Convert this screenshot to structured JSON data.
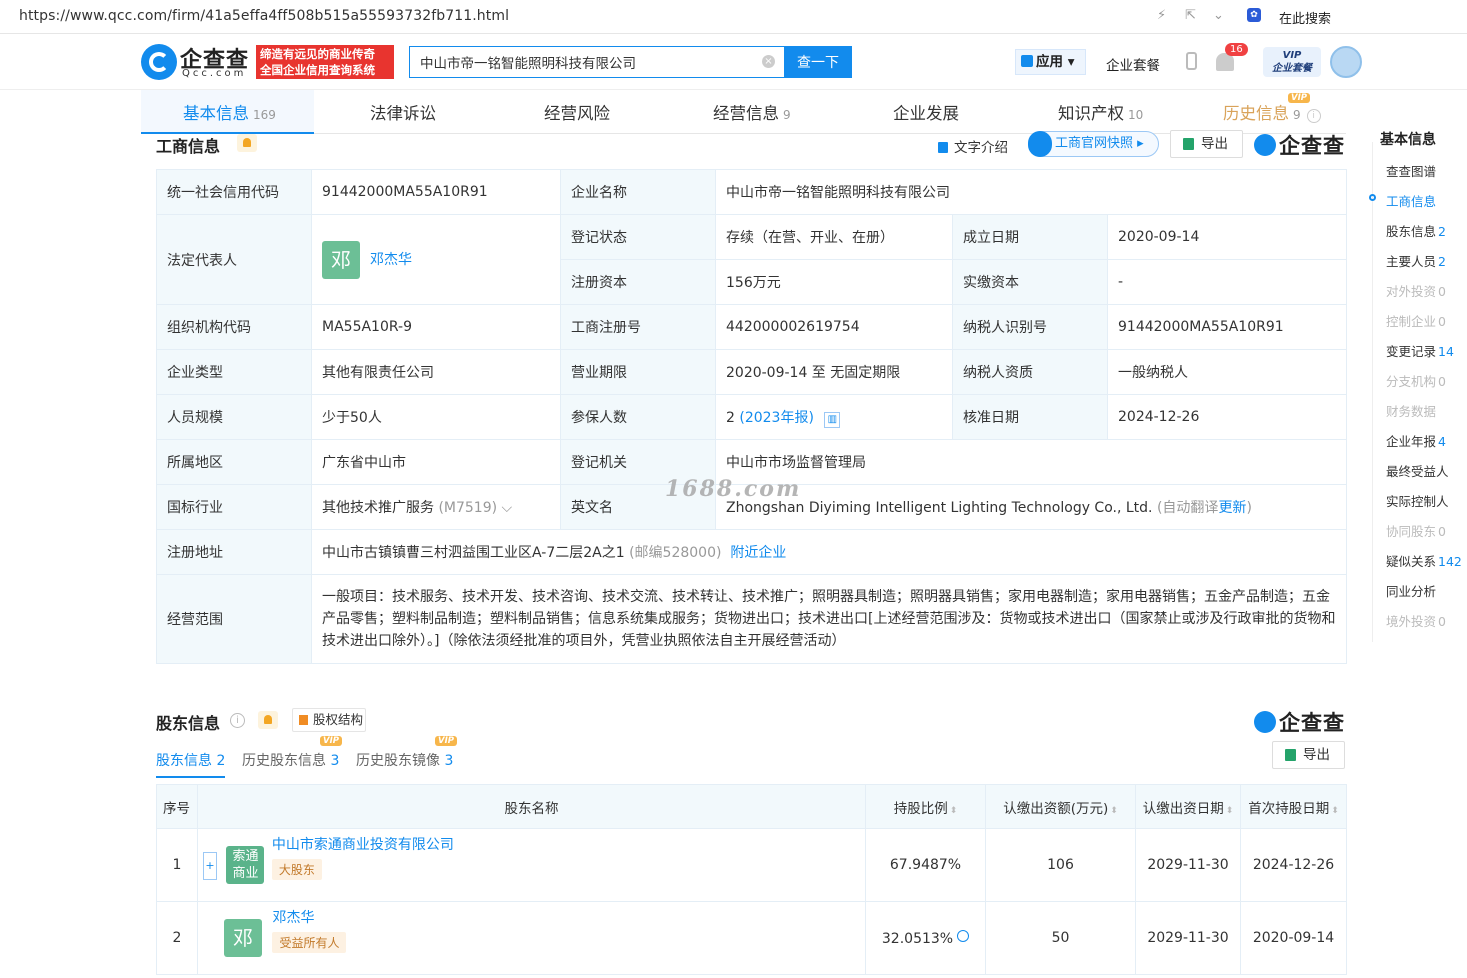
{
  "browser": {
    "url": "https://www.qcc.com/firm/41a5effa4ff508b515a55593732fb711.html",
    "search_label": "在此搜索"
  },
  "header": {
    "logo_text": "企查查",
    "logo_sub": "Qcc.com",
    "slogan_line1": "缔造有远见的商业传奇",
    "slogan_line2": "全国企业信用查询系统",
    "search_value": "中山市帝一铭智能照明科技有限公司",
    "search_button": "查一下",
    "apps_label": "应用",
    "package_label": "企业套餐",
    "notification_count": "16",
    "vip_line1": "VIP",
    "vip_line2": "企业套餐"
  },
  "tabs": [
    {
      "label": "基本信息",
      "count": "169"
    },
    {
      "label": "法律诉讼",
      "count": ""
    },
    {
      "label": "经营风险",
      "count": ""
    },
    {
      "label": "经营信息",
      "count": "9"
    },
    {
      "label": "企业发展",
      "count": ""
    },
    {
      "label": "知识产权",
      "count": "10"
    },
    {
      "label": "历史信息",
      "count": "9"
    }
  ],
  "vip_tag": "VIP",
  "biz": {
    "title": "工商信息",
    "text_intro": "文字介绍",
    "snapshot": "工商官网快照",
    "export": "导出",
    "brand": "企查查"
  },
  "fields": {
    "credit_code_k": "统一社会信用代码",
    "credit_code_v": "91442000MA55A10R91",
    "name_k": "企业名称",
    "name_v": "中山市帝一铭智能照明科技有限公司",
    "legal_k": "法定代表人",
    "legal_avatar": "邓",
    "legal_v": "邓杰华",
    "status_k": "登记状态",
    "status_v": "存续（在营、开业、在册）",
    "found_k": "成立日期",
    "found_v": "2020-09-14",
    "capital_k": "注册资本",
    "capital_v": "156万元",
    "paid_k": "实缴资本",
    "paid_v": "-",
    "org_k": "组织机构代码",
    "org_v": "MA55A10R-9",
    "regno_k": "工商注册号",
    "regno_v": "442000002619754",
    "tax_k": "纳税人识别号",
    "tax_v": "91442000MA55A10R91",
    "type_k": "企业类型",
    "type_v": "其他有限责任公司",
    "term_k": "营业期限",
    "term_v": "2020-09-14 至 无固定期限",
    "taxq_k": "纳税人资质",
    "taxq_v": "一般纳税人",
    "size_k": "人员规模",
    "size_v": "少于50人",
    "ins_k": "参保人数",
    "ins_v": "2",
    "ins_link": "(2023年报)",
    "approve_k": "核准日期",
    "approve_v": "2024-12-26",
    "region_k": "所属地区",
    "region_v": "广东省中山市",
    "auth_k": "登记机关",
    "auth_v": "中山市市场监督管理局",
    "industry_k": "国标行业",
    "industry_v": "其他技术推广服务",
    "industry_code": "(M7519)",
    "en_k": "英文名",
    "en_v": "Zhongshan Diyiming Intelligent Lighting Technology Co., Ltd.",
    "en_note": "(自动翻译",
    "en_update": "更新",
    "addr_k": "注册地址",
    "addr_v": "中山市古镇镇曹三村泗益围工业区A-7二层2A之1",
    "addr_zip": "(邮编528000)",
    "addr_near": "附近企业",
    "scope_k": "经营范围",
    "scope_v": "一般项目：技术服务、技术开发、技术咨询、技术交流、技术转让、技术推广；照明器具制造；照明器具销售；家用电器制造；家用电器销售；五金产品制造；五金产品零售；塑料制品制造；塑料制品销售；信息系统集成服务；货物进出口；技术进出口[上述经营范围涉及：货物或技术进出口（国家禁止或涉及行政审批的货物和技术进出口除外）。]（除依法须经批准的项目外，凭营业执照依法自主开展经营活动）"
  },
  "watermark": "1688.com",
  "rightnav": {
    "title": "基本信息",
    "items": [
      {
        "label": "查查图谱",
        "count": ""
      },
      {
        "label": "工商信息",
        "count": ""
      },
      {
        "label": "股东信息",
        "count": "2"
      },
      {
        "label": "主要人员",
        "count": "2"
      },
      {
        "label": "对外投资",
        "count": "0"
      },
      {
        "label": "控制企业",
        "count": "0"
      },
      {
        "label": "变更记录",
        "count": "14"
      },
      {
        "label": "分支机构",
        "count": "0"
      },
      {
        "label": "财务数据",
        "count": ""
      },
      {
        "label": "企业年报",
        "count": "4"
      },
      {
        "label": "最终受益人",
        "count": ""
      },
      {
        "label": "实际控制人",
        "count": ""
      },
      {
        "label": "协同股东",
        "count": "0"
      },
      {
        "label": "疑似关系",
        "count": "142"
      },
      {
        "label": "同业分析",
        "count": ""
      },
      {
        "label": "境外投资",
        "count": "0"
      }
    ]
  },
  "shareholders": {
    "title": "股东信息",
    "equity_btn": "股权结构",
    "export": "导出",
    "brand": "企查查",
    "subtabs": [
      {
        "label": "股东信息",
        "count": "2"
      },
      {
        "label": "历史股东信息",
        "count": "3"
      },
      {
        "label": "历史股东镜像",
        "count": "3"
      }
    ],
    "columns": [
      "序号",
      "股东名称",
      "持股比例",
      "认缴出资额(万元)",
      "认缴出资日期",
      "首次持股日期"
    ],
    "rows": [
      {
        "no": "1",
        "logo_l1": "索通",
        "logo_l2": "商业",
        "name": "中山市索通商业投资有限公司",
        "tag": "大股东",
        "ratio": "67.9487%",
        "amount": "106",
        "date": "2029-11-30",
        "first": "2024-12-26"
      },
      {
        "no": "2",
        "avatar": "邓",
        "name": "邓杰华",
        "tag": "受益所有人",
        "ratio": "32.0513%",
        "amount": "50",
        "date": "2029-11-30",
        "first": "2020-09-14"
      }
    ]
  }
}
